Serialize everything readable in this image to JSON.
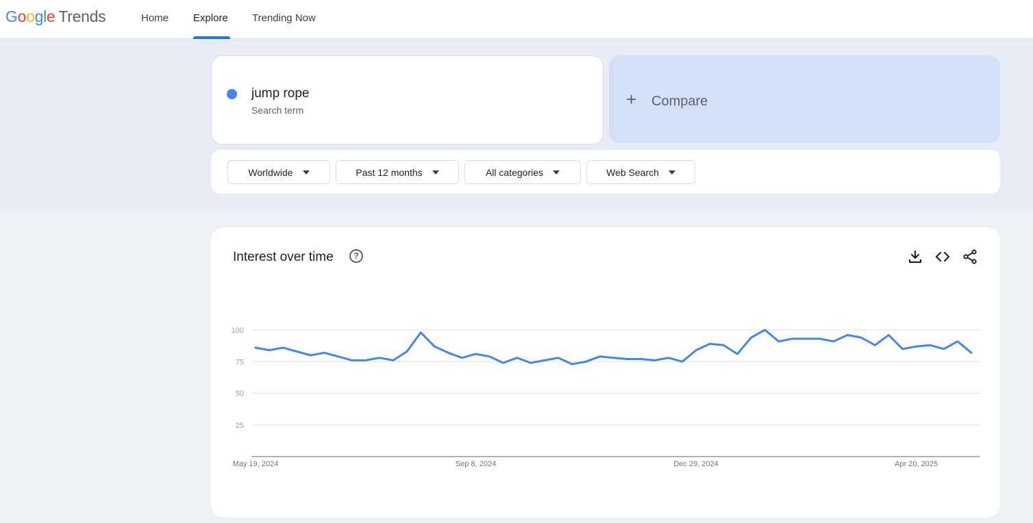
{
  "header": {
    "logo_google": [
      "G",
      "o",
      "o",
      "g",
      "l",
      "e"
    ],
    "logo_product": "Trends",
    "tabs": [
      {
        "label": "Home"
      },
      {
        "label": "Explore"
      },
      {
        "label": "Trending Now"
      }
    ],
    "active_tab": "Explore"
  },
  "search": {
    "term": "jump rope",
    "term_type": "Search term",
    "term_color": "#4285f4",
    "compare_label": "Compare"
  },
  "filters": {
    "region": "Worldwide",
    "time_range": "Past 12 months",
    "category": "All categories",
    "property": "Web Search"
  },
  "widget": {
    "title": "Interest over time",
    "icons": [
      "help-icon",
      "download-icon",
      "embed-icon",
      "share-icon"
    ]
  },
  "chart_data": {
    "type": "line",
    "title": "",
    "xlabel": "",
    "ylabel": "",
    "ylim": [
      0,
      100
    ],
    "yticks": [
      25,
      50,
      75,
      100
    ],
    "grid": true,
    "x_tick_labels": [
      "May 19, 2024",
      "Sep 8, 2024",
      "Dec 29, 2024",
      "Apr 20, 2025"
    ],
    "x_tick_indices": [
      0,
      16,
      32,
      48
    ],
    "series": [
      {
        "color": "#4285f4",
        "values": [
          86,
          84,
          86,
          83,
          80,
          82,
          79,
          76,
          76,
          78,
          76,
          83,
          98,
          87,
          82,
          78,
          81,
          79,
          74,
          78,
          74,
          76,
          78,
          73,
          75,
          79,
          78,
          77,
          77,
          76,
          78,
          75,
          84,
          89,
          88,
          81,
          94,
          100,
          91,
          93,
          93,
          93,
          91,
          96,
          94,
          88,
          96,
          85,
          87,
          88,
          85,
          91,
          82
        ]
      }
    ]
  }
}
